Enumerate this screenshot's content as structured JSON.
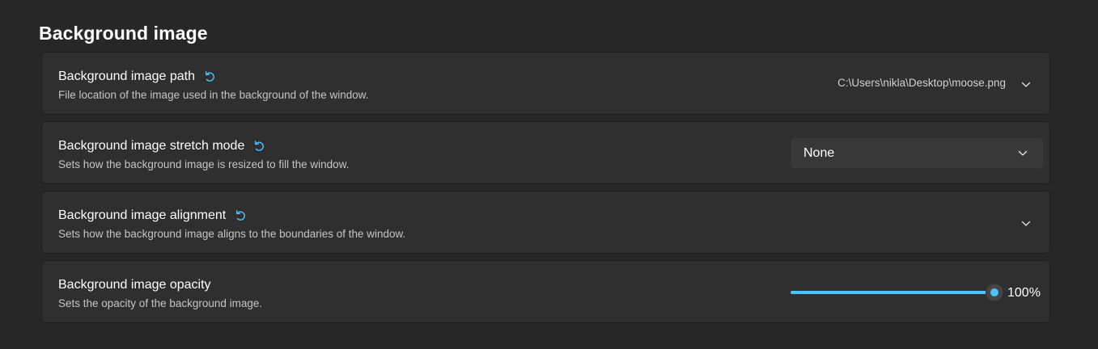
{
  "section": {
    "title": "Background image"
  },
  "settings": [
    {
      "label": "Background image path",
      "description": "File location of the image used in the background of the window.",
      "value": "C:\\Users\\nikla\\Desktop\\moose.png",
      "has_reset": true
    },
    {
      "label": "Background image stretch mode",
      "description": "Sets how the background image is resized to fill the window.",
      "value": "None",
      "has_reset": true
    },
    {
      "label": "Background image alignment",
      "description": "Sets how the background image aligns to the boundaries of the window.",
      "has_reset": true
    },
    {
      "label": "Background image opacity",
      "description": "Sets the opacity of the background image.",
      "value_text": "100%",
      "value_percent": 100
    }
  ],
  "colors": {
    "accent": "#4cc2ff",
    "card": "#2f2f2f",
    "background": "#272727"
  },
  "icons": {
    "reset": "reset-icon",
    "expand": "chevron-down-icon"
  }
}
